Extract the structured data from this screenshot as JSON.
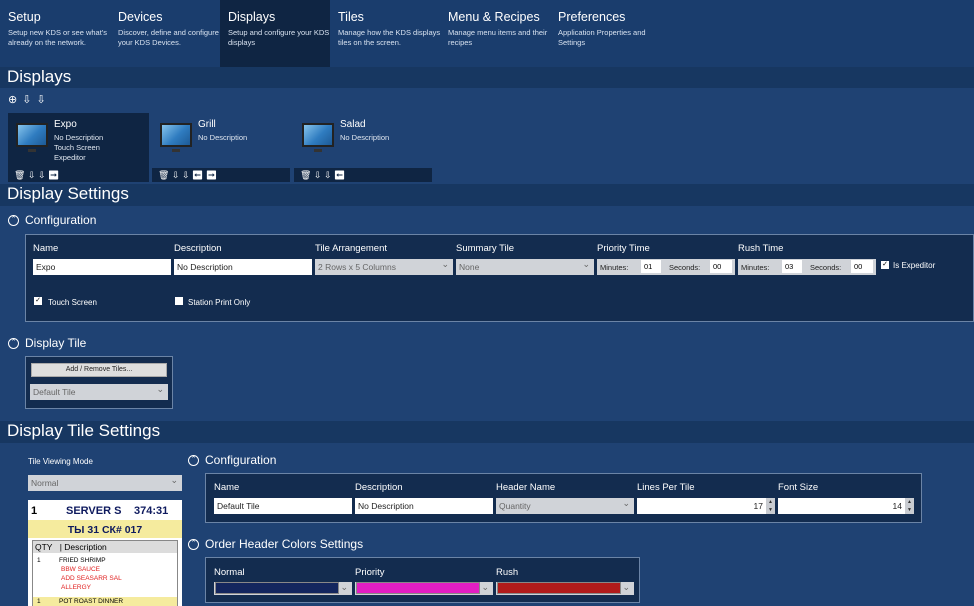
{
  "nav": {
    "tabs": [
      {
        "title": "Setup",
        "desc": "Setup new KDS or see what's already on the network."
      },
      {
        "title": "Devices",
        "desc": "Discover, define and configure your KDS Devices."
      },
      {
        "title": "Displays",
        "desc": "Setup and configure your KDS displays"
      },
      {
        "title": "Tiles",
        "desc": "Manage how the KDS displays tiles on the screen."
      },
      {
        "title": "Menu & Recipes",
        "desc": "Manage menu items and their recipes"
      },
      {
        "title": "Preferences",
        "desc": "Application Properties and Settings"
      }
    ]
  },
  "displays": {
    "heading": "Displays",
    "toolbar_icons": "⊕ ⇩ ⇩",
    "cards": [
      {
        "name": "Expo",
        "desc": "No Description",
        "line2": "Touch Screen",
        "line3": "Expeditor",
        "actions": "🗑 ⇩ ⇩ ➡"
      },
      {
        "name": "Grill",
        "desc": "No Description",
        "line2": "",
        "line3": "",
        "actions": "🗑 ⇩ ⇩ ⬅ ➡"
      },
      {
        "name": "Salad",
        "desc": "No Description",
        "line2": "",
        "line3": "",
        "actions": "🗑 ⇩ ⇩ ⬅"
      }
    ]
  },
  "display_settings": {
    "heading": "Display Settings",
    "configuration": {
      "label": "Configuration",
      "name_label": "Name",
      "name_value": "Expo",
      "desc_label": "Description",
      "desc_value": "No Description",
      "tile_arr_label": "Tile Arrangement",
      "tile_arr_value": "2 Rows x 5 Columns",
      "summary_label": "Summary Tile",
      "summary_value": "None",
      "priority_label": "Priority Time",
      "rush_label": "Rush Time",
      "minutes_label": "Minutes:",
      "seconds_label": "Seconds:",
      "priority_min": "01",
      "priority_sec": "00",
      "rush_min": "03",
      "rush_sec": "00",
      "is_expeditor_label": "Is Expeditor",
      "touch_screen_label": "Touch Screen",
      "station_print_label": "Station Print Only"
    },
    "display_tile": {
      "label": "Display Tile",
      "add_remove_button": "Add / Remove Tiles...",
      "tile_select_value": "Default Tile"
    }
  },
  "tile_settings": {
    "heading": "Display Tile Settings",
    "viewing_mode_label": "Tile Viewing Mode",
    "viewing_mode_value": "Normal",
    "preview": {
      "seat": "1",
      "server": "SERVER S",
      "time": "374:31",
      "ticket": "ТЫ 31 СК# 017",
      "col_qty": "QTY",
      "col_desc": "| Description",
      "items": [
        {
          "qty": "1",
          "name": "FRIED SHRIMP",
          "mods": [
            "BBW SAUCE",
            "ADD SEASARR SAL",
            "ALLERGY"
          ]
        },
        {
          "qty": "1",
          "name": "POT ROAST DINNER",
          "mods": []
        }
      ]
    },
    "configuration": {
      "label": "Configuration",
      "name_label": "Name",
      "name_value": "Default Tile",
      "desc_label": "Description",
      "desc_value": "No Description",
      "header_label": "Header Name",
      "header_value": "Quantity",
      "lines_label": "Lines Per Tile",
      "lines_value": "17",
      "font_label": "Font Size",
      "font_value": "14"
    },
    "order_header_colors": {
      "label": "Order Header Colors Settings",
      "normal_label": "Normal",
      "priority_label": "Priority",
      "rush_label": "Rush",
      "normal_color": "#13265e",
      "priority_color": "#e21ec3",
      "rush_color": "#b01b1b"
    }
  }
}
